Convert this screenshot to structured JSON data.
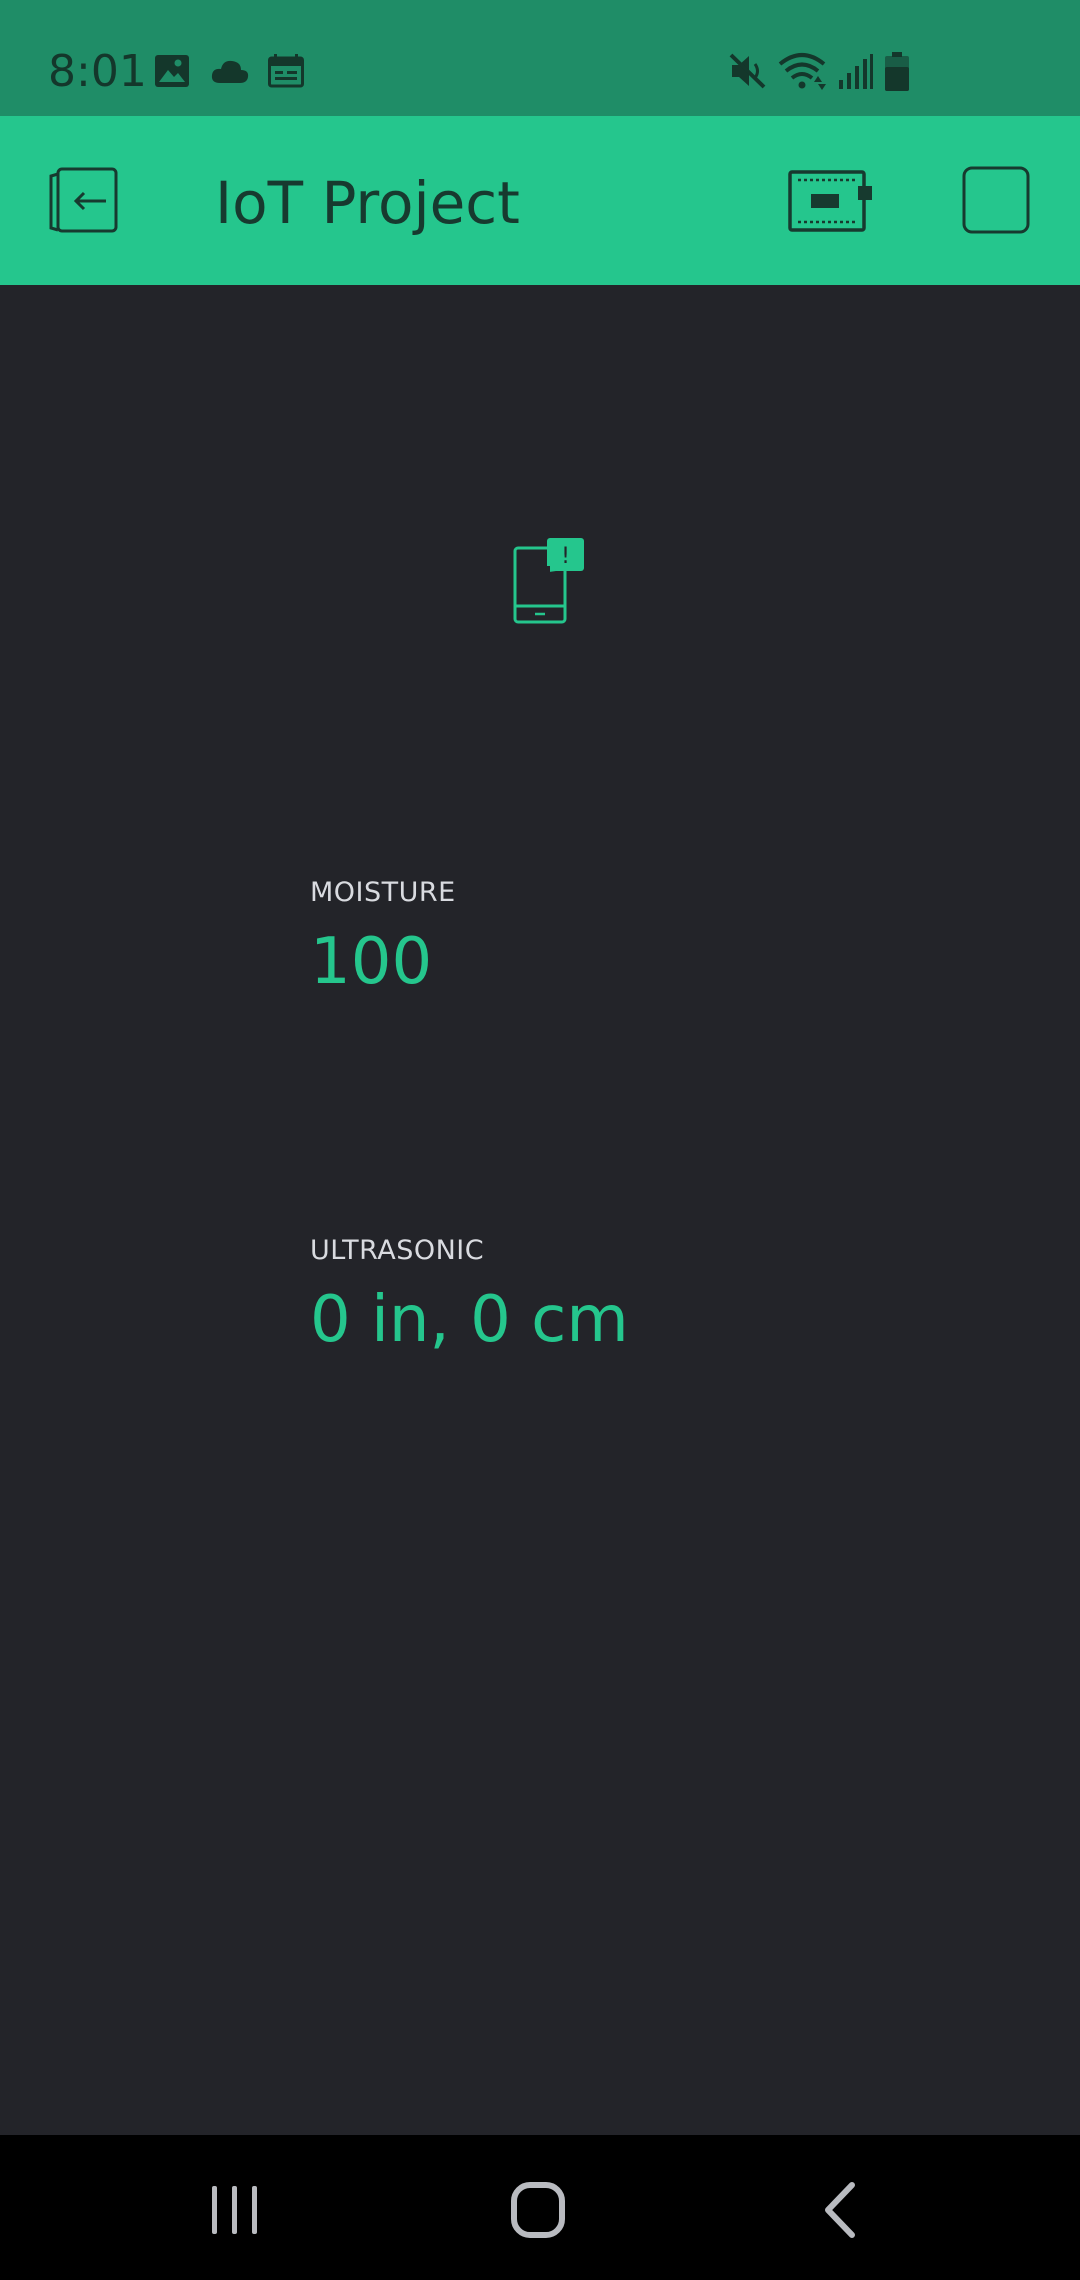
{
  "status_bar": {
    "time": "8:01",
    "left_icons": [
      "image-icon",
      "cloud-icon",
      "calendar-icon"
    ],
    "right_icons": [
      "mute-icon",
      "wifi-icon",
      "signal-icon",
      "battery-icon"
    ]
  },
  "app_bar": {
    "title": "IoT Project",
    "icons": [
      "back-icon",
      "device-icon",
      "stop-icon"
    ]
  },
  "notification": {
    "icon": "phone-alert-icon",
    "badge": "!"
  },
  "widgets": [
    {
      "label": "MOISTURE",
      "value": "100"
    },
    {
      "label": "ULTRASONIC",
      "value": "0 in, 0 cm"
    }
  ],
  "nav_bar": {
    "icons": [
      "recents-icon",
      "home-icon",
      "back-nav-icon"
    ]
  },
  "colors": {
    "status_bar_bg": "#1f8d67",
    "app_bar_bg": "#25c68d",
    "content_bg": "#232429",
    "accent": "#25c68d",
    "nav_bar_bg": "#000000"
  }
}
